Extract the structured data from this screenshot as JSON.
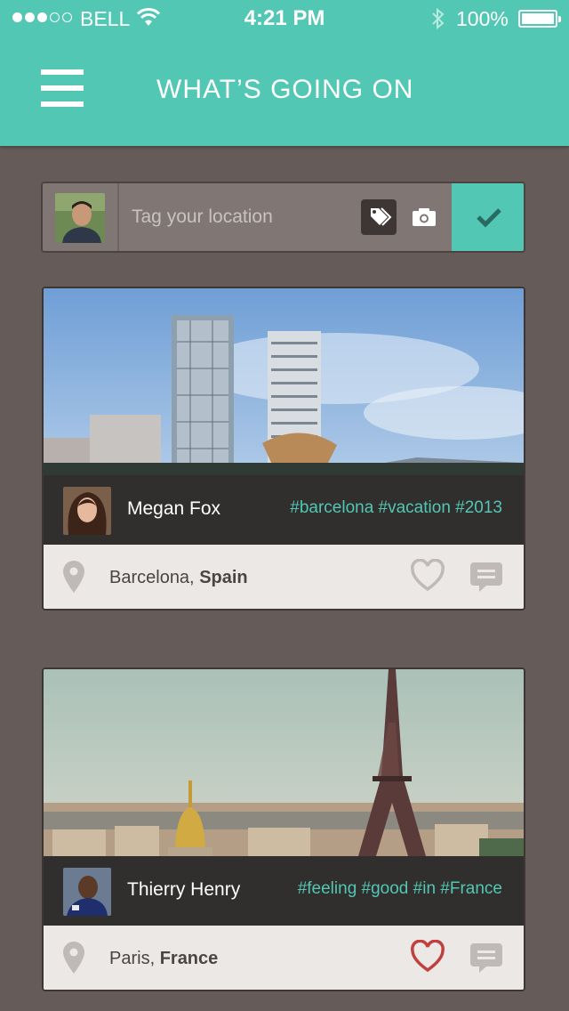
{
  "status_bar": {
    "carrier": "BELL",
    "time": "4:21 PM",
    "battery": "100%"
  },
  "header": {
    "title": "WHAT’S GOING ON"
  },
  "composer": {
    "placeholder": "Tag your location"
  },
  "posts": [
    {
      "user": "Megan Fox",
      "hashtags": "#barcelona #vacation #2013",
      "city": "Barcelona,",
      "country": "Spain",
      "liked": false
    },
    {
      "user": "Thierry Henry",
      "hashtags": "#feeling #good #in #France",
      "city": "Paris,",
      "country": "France",
      "liked": true
    }
  ],
  "colors": {
    "accent": "#52c7b3",
    "background": "#655b58",
    "liked_heart": "#c0403f",
    "unliked_heart": "#bfbab7"
  },
  "icons": [
    "menu-icon",
    "tag-icon",
    "camera-icon",
    "checkmark-icon",
    "location-pin-icon",
    "heart-icon",
    "comment-icon",
    "wifi-icon",
    "bluetooth-icon",
    "battery-icon"
  ]
}
